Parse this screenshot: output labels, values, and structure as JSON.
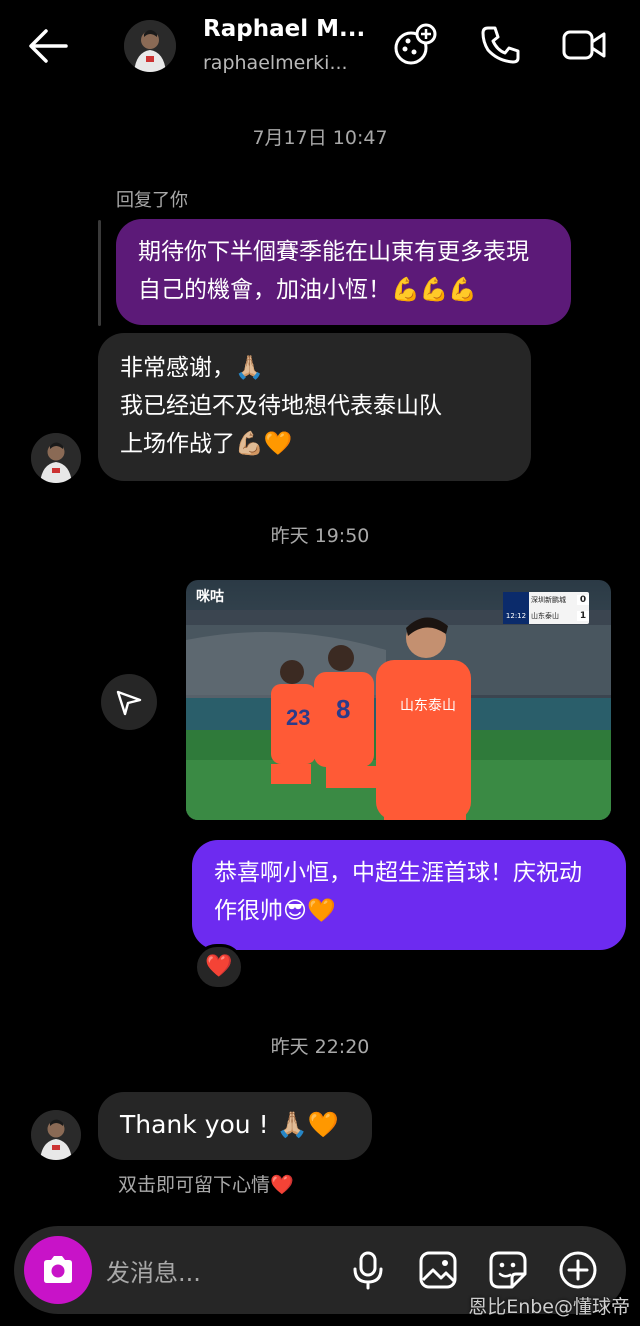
{
  "header": {
    "name": "Raphael M...",
    "username": "raphaelmerki..."
  },
  "messages": {
    "ts1": "7月17日 10:47",
    "reply_label": "回复了你",
    "quoted": "期待你下半個賽季能在山東有更多表現自己的機會，加油小恆！💪💪💪",
    "reply_line1": "非常感谢，🙏🏼",
    "reply_line2": "我已经迫不及待地想代表泰山队",
    "reply_line3": "上场作战了💪🏼🧡",
    "ts2": "昨天 19:50",
    "photo_brand": "咪咕",
    "score": {
      "team1": "深圳新鹏城",
      "score1": "0",
      "team2": "山东泰山",
      "score2": "1",
      "clock": "12:12"
    },
    "sent2": "恭喜啊小恒，中超生涯首球！庆祝动作很帅😎🧡",
    "reaction": "❤️",
    "ts3": "昨天 22:20",
    "thanks": "Thank you ! 🙏🏼🧡",
    "hint": "双击即可留下心情❤️"
  },
  "composer": {
    "placeholder": "发消息..."
  },
  "watermark": "恩比Enbe@懂球帝",
  "colors": {
    "quoted_bubble": "#5c1a78",
    "sent_bubble": "#6d2bf0",
    "received_bubble": "#262626",
    "camera_button": "#c813c8"
  }
}
